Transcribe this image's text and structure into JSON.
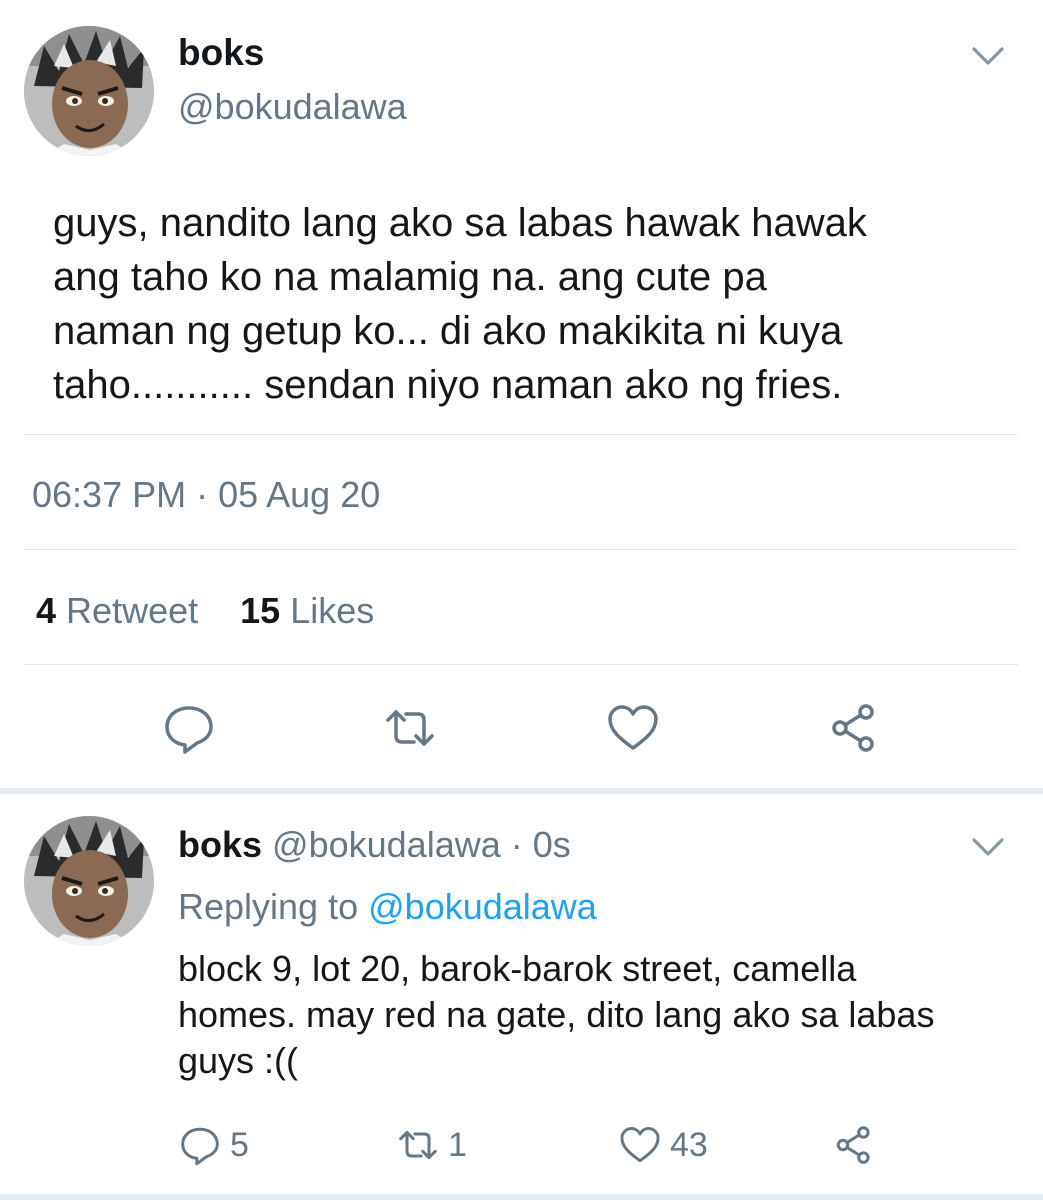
{
  "main_tweet": {
    "display_name": "boks",
    "handle": "@bokudalawa",
    "text": "guys, nandito lang ako sa labas hawak hawak\nang taho ko na malamig na. ang cute pa\nnaman ng getup ko... di ako makikita ni kuya\ntaho........... sendan niyo naman ako ng fries.",
    "timestamp": "06:37 PM · 05 Aug 20",
    "retweet_count": "4",
    "retweet_label": "Retweet",
    "like_count": "15",
    "like_label": "Likes",
    "avatar_icon": "avatar-icon",
    "menu_icon": "chevron-down-icon",
    "actions": [
      "reply-icon",
      "retweet-icon",
      "like-icon",
      "share-icon"
    ]
  },
  "reply_tweet": {
    "display_name": "boks",
    "handle_time": "@bokudalawa · 0s",
    "replying_prefix": "Replying to",
    "replying_mention": "@bokudalawa",
    "text": "block 9, lot 20, barok-barok street, camella\nhomes. may red na gate, dito lang ako sa labas\nguys :((",
    "reply_count": "5",
    "retweet_count": "1",
    "like_count": "43",
    "avatar_icon": "avatar-icon",
    "menu_icon": "chevron-down-icon"
  },
  "colors": {
    "text_primary": "#14171a",
    "text_secondary": "#657786",
    "link": "#1da1f2",
    "divider": "#e1e8ed",
    "icon": "#657786"
  }
}
